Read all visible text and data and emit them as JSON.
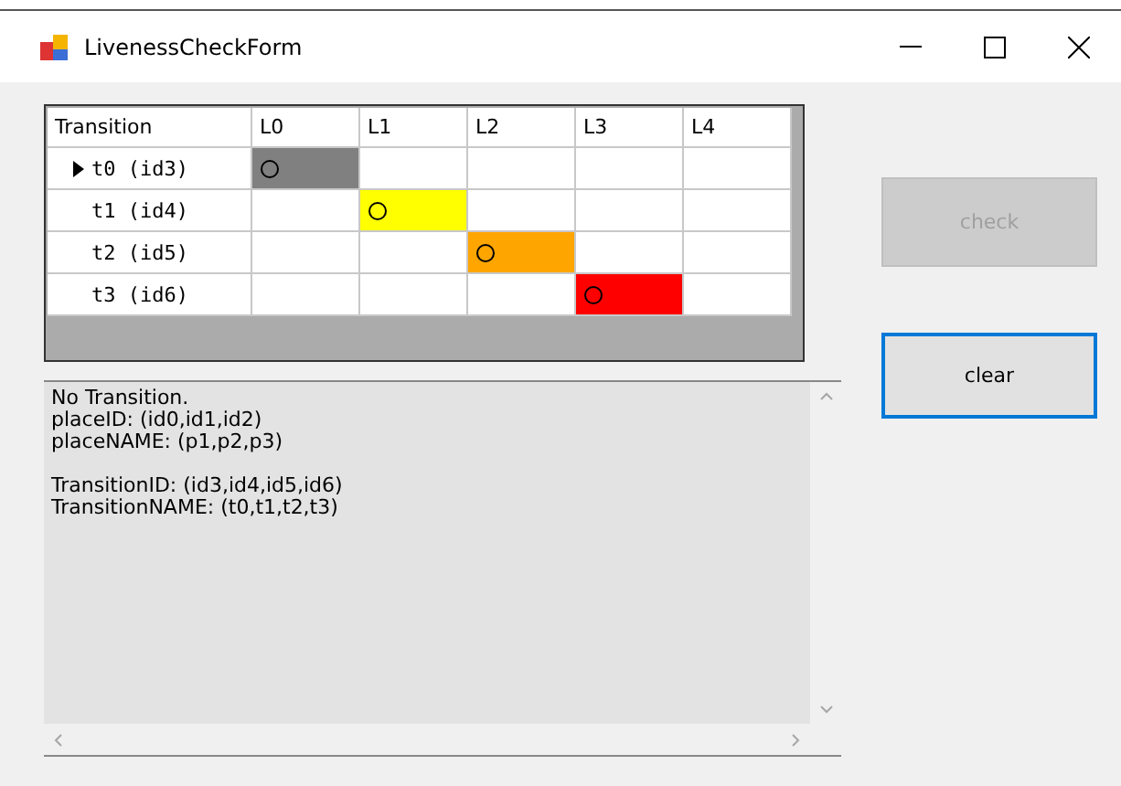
{
  "window": {
    "title": "LivenessCheckForm"
  },
  "grid": {
    "columns": [
      "Transition",
      "L0",
      "L1",
      "L2",
      "L3",
      "L4"
    ],
    "rows": [
      {
        "label": "t0  (id3)",
        "selected": true,
        "cells": [
          {
            "marked": true,
            "color": "#808080"
          },
          {
            "marked": false
          },
          {
            "marked": false
          },
          {
            "marked": false
          },
          {
            "marked": false
          }
        ]
      },
      {
        "label": "t1  (id4)",
        "selected": false,
        "cells": [
          {
            "marked": false
          },
          {
            "marked": true,
            "color": "#ffff00"
          },
          {
            "marked": false
          },
          {
            "marked": false
          },
          {
            "marked": false
          }
        ]
      },
      {
        "label": "t2  (id5)",
        "selected": false,
        "cells": [
          {
            "marked": false
          },
          {
            "marked": false
          },
          {
            "marked": true,
            "color": "#ffa500"
          },
          {
            "marked": false
          },
          {
            "marked": false
          }
        ]
      },
      {
        "label": "t3  (id6)",
        "selected": false,
        "cells": [
          {
            "marked": false
          },
          {
            "marked": false
          },
          {
            "marked": false
          },
          {
            "marked": true,
            "color": "#ff0000"
          },
          {
            "marked": false
          }
        ]
      }
    ]
  },
  "output": {
    "paragraphs": [
      [
        "No Transition.",
        "placeID: (id0,id1,id2)",
        "placeNAME: (p1,p2,p3)"
      ],
      [
        "TransitionID: (id3,id4,id5,id6)",
        "TransitionNAME: (t0,t1,t2,t3)"
      ]
    ]
  },
  "buttons": [
    {
      "label": "check",
      "disabled": true,
      "focused": false
    },
    {
      "label": "clear",
      "disabled": false,
      "focused": true
    }
  ]
}
